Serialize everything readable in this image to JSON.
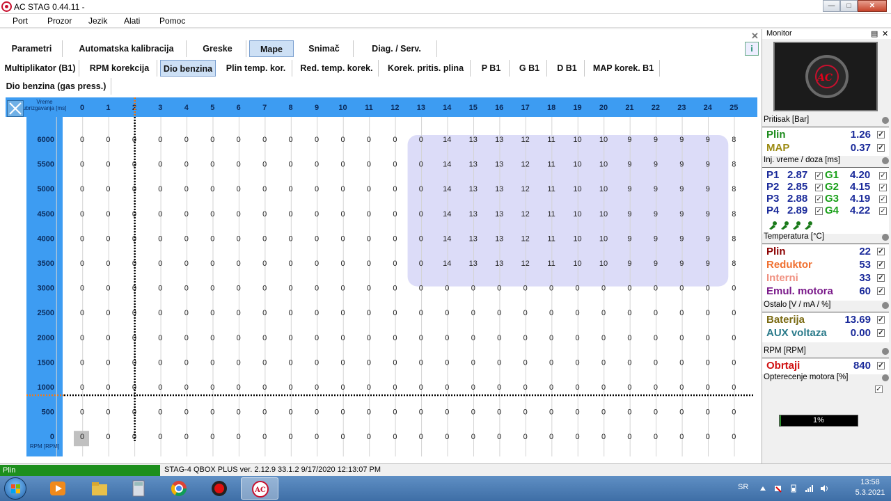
{
  "app": {
    "title": "AC STAG 0.44.11 -"
  },
  "menu": [
    "Port",
    "Prozor",
    "Jezik",
    "Alati",
    "Pomoc"
  ],
  "tabs_main": [
    {
      "label": "Parametri",
      "active": false
    },
    {
      "label": "Automatska kalibracija",
      "active": false
    },
    {
      "label": "Greske",
      "active": false
    },
    {
      "label": "Mape",
      "active": true
    },
    {
      "label": "Snimač",
      "active": false
    },
    {
      "label": "Diag. / Serv.",
      "active": false
    }
  ],
  "tabs_map": [
    {
      "label": "Multiplikator (B1)",
      "active": false
    },
    {
      "label": "RPM korekcija",
      "active": false
    },
    {
      "label": "Dio benzina",
      "active": true
    },
    {
      "label": "Plin temp. kor.",
      "active": false
    },
    {
      "label": "Red. temp. korek.",
      "active": false
    },
    {
      "label": "Korek. pritis. plina",
      "active": false
    },
    {
      "label": "P B1",
      "active": false
    },
    {
      "label": "G B1",
      "active": false
    },
    {
      "label": "D B1",
      "active": false
    },
    {
      "label": "MAP korek. B1",
      "active": false
    }
  ],
  "tabs_sub": [
    {
      "label": "Dio benzina (gas press.)",
      "active": false
    }
  ],
  "grid": {
    "corner_label": "Vreme ubrizgavanja [ms]",
    "rpm_label": "RPM [RPM]",
    "x_cols": [
      "0",
      "1",
      "2",
      "3",
      "4",
      "5",
      "6",
      "7",
      "8",
      "9",
      "10",
      "11",
      "12",
      "13",
      "14",
      "15",
      "16",
      "17",
      "18",
      "19",
      "20",
      "21",
      "22",
      "23",
      "24",
      "25"
    ],
    "y_rows": [
      "6000",
      "5500",
      "5000",
      "4500",
      "4000",
      "3500",
      "3000",
      "2500",
      "2000",
      "1500",
      "1000",
      "500",
      "0"
    ],
    "row_values": {
      "hi": [
        0,
        0,
        0,
        0,
        0,
        0,
        0,
        0,
        0,
        0,
        0,
        0,
        0,
        0,
        14,
        13,
        13,
        12,
        11,
        10,
        10,
        9,
        9,
        9,
        9,
        8
      ]
    },
    "hi_rows": 6,
    "highlight_from_col": 14,
    "highlight_color": "#dcdcf8",
    "header_color": "#3d9cf2",
    "cursor_col": 3,
    "cursor_row_index": 10,
    "selected_cell": {
      "row": 12,
      "col": 0
    }
  },
  "monitor": {
    "title": "Monitor",
    "sections": {
      "pressure": "Pritisak [Bar]",
      "inj": "Inj. vreme / doza [ms]",
      "temp": "Temperatura [°C]",
      "other": "Ostalo [V / mA / %]",
      "rpm": "RPM [RPM]",
      "load": "Opterecenje motora [%]"
    },
    "pressure": [
      {
        "label": "Plin",
        "value": "1.26",
        "color": "#1a8a1a"
      },
      {
        "label": "MAP",
        "value": "0.37",
        "color": "#9b8a12"
      }
    ],
    "injection": [
      {
        "p": "P1",
        "pv": "2.87",
        "g": "G1",
        "gv": "4.20"
      },
      {
        "p": "P2",
        "pv": "2.85",
        "g": "G2",
        "gv": "4.15"
      },
      {
        "p": "P3",
        "pv": "2.88",
        "g": "G3",
        "gv": "4.19"
      },
      {
        "p": "P4",
        "pv": "2.89",
        "g": "G4",
        "gv": "4.22"
      }
    ],
    "temperature": [
      {
        "label": "Plin",
        "value": "22",
        "color": "#8b0000"
      },
      {
        "label": "Reduktor",
        "value": "53",
        "color": "#f07030"
      },
      {
        "label": "Interni",
        "value": "33",
        "color": "#f09080"
      },
      {
        "label": "Emul. motora",
        "value": "60",
        "color": "#7a1a8a"
      }
    ],
    "other": [
      {
        "label": "Baterija",
        "value": "13.69",
        "color": "#7a6a12"
      },
      {
        "label": "AUX voltaza",
        "value": "0.00",
        "color": "#2a7a8a"
      }
    ],
    "rpm": [
      {
        "label": "Obrtaji",
        "value": "840",
        "color": "#d01010"
      }
    ],
    "load": {
      "text": "1%",
      "fraction": 0.01
    }
  },
  "status": {
    "left": "Plin",
    "right": "STAG-4 QBOX PLUS  ver. 2.12.9  33.1.2  9/17/2020 12:13:07 PM"
  },
  "taskbar": {
    "lang": "SR",
    "time": "13:58",
    "date": "5.3.2021"
  }
}
